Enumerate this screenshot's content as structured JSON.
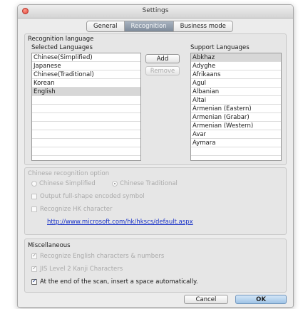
{
  "window": {
    "title": "Settings",
    "tabs": [
      {
        "label": "General",
        "active": false
      },
      {
        "label": "Recognition",
        "active": true
      },
      {
        "label": "Business mode",
        "active": false
      }
    ]
  },
  "recognition_language": {
    "heading": "Recognition language",
    "selected_header": "Selected Languages",
    "selected": [
      "Chinese(Simplified)",
      "Japanese",
      "Chinese(Traditional)",
      "Korean",
      "English"
    ],
    "selected_highlight_index": 4,
    "add_label": "Add",
    "remove_label": "Remove",
    "support_header": "Support Languages",
    "supported": [
      "Abkhaz",
      "Adyghe",
      "Afrikaans",
      "Agul",
      "Albanian",
      "Altai",
      "Armenian (Eastern)",
      "Armenian (Grabar)",
      "Armenian (Western)",
      "Avar",
      "Aymara"
    ],
    "supported_highlight_index": 0
  },
  "chinese_options": {
    "heading": "Chinese recognition option",
    "simplified_label": "Chinese Simplified",
    "traditional_label": "Chinese Traditional",
    "full_shape_label": "Output full-shape encoded symbol",
    "hk_label": "Recognize HK character",
    "hk_link": "http://www.microsoft.com/hk/hkscs/default.aspx"
  },
  "misc": {
    "heading": "Miscellaneous",
    "english_numbers_label": "Recognize English characters & numbers",
    "jis_label": "JIS Level 2 Kanji Characters",
    "space_label": "At the end of the scan, insert a space automatically."
  },
  "footer": {
    "cancel_label": "Cancel",
    "ok_label": "OK"
  }
}
